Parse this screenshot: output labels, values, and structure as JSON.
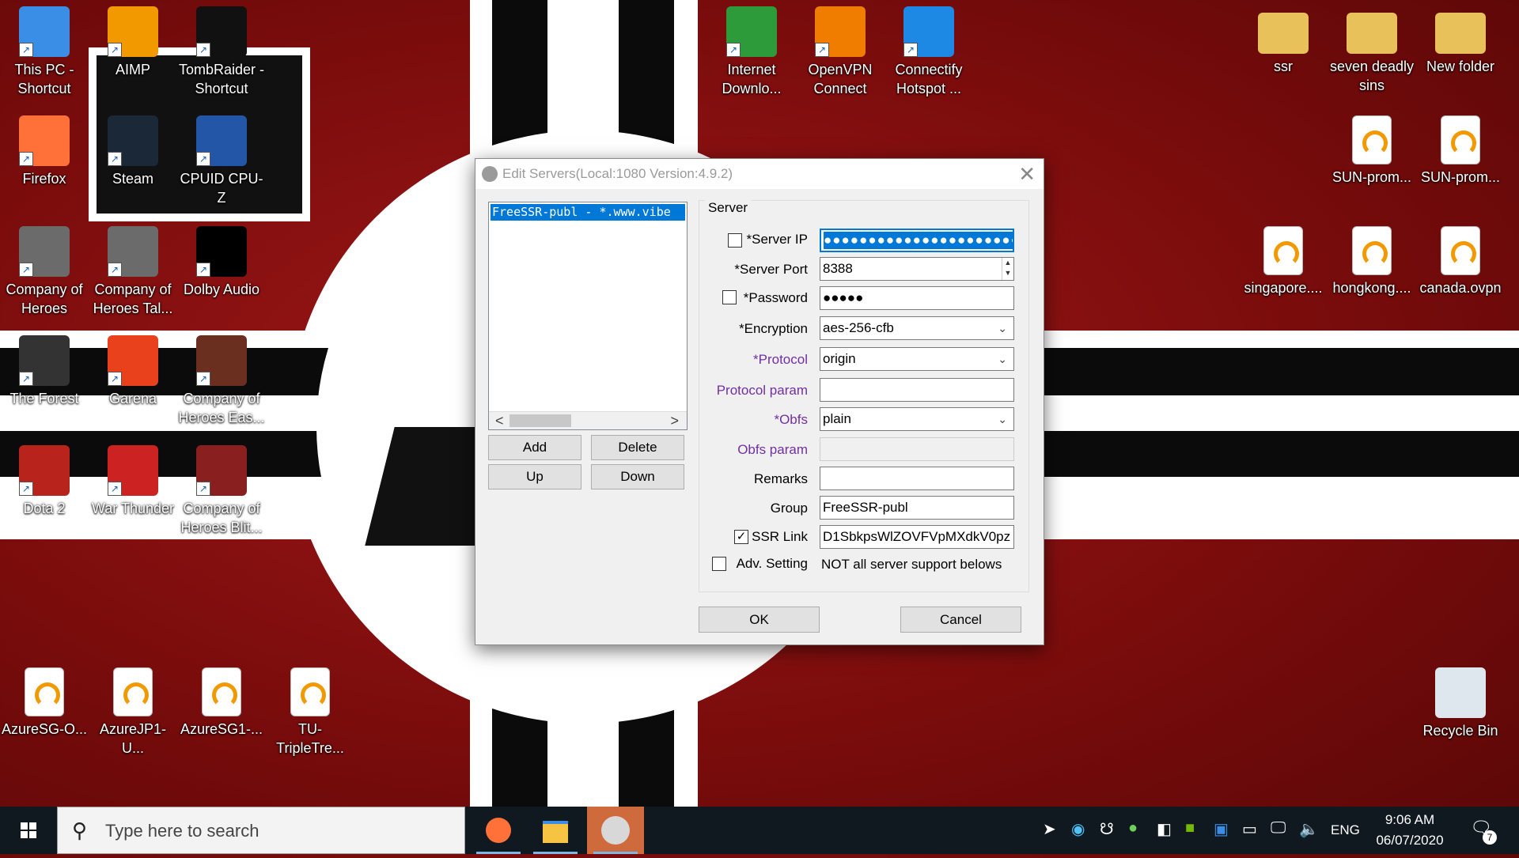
{
  "desktop": {
    "icons_left": [
      {
        "label": "This PC - Shortcut",
        "icon": "this-pc-icon",
        "color": "#3a8ee6"
      },
      {
        "label": "AIMP",
        "icon": "aimp-icon",
        "color": "#f29900"
      },
      {
        "label": "TombRaider - Shortcut",
        "icon": "tomb-raider-icon",
        "color": "#111111"
      },
      {
        "label": "Firefox",
        "icon": "firefox-icon",
        "color": "#ff7139"
      },
      {
        "label": "Steam",
        "icon": "steam-icon",
        "color": "#1b2838"
      },
      {
        "label": "CPUID CPU-Z",
        "icon": "cpuz-icon",
        "color": "#2456a8"
      },
      {
        "label": "Company of Heroes",
        "icon": "company-of-heroes-icon",
        "color": "#6b6b6b"
      },
      {
        "label": "Company of Heroes Tal...",
        "icon": "company-of-heroes-tales-icon",
        "color": "#6b6b6b"
      },
      {
        "label": "Dolby Audio",
        "icon": "dolby-audio-icon",
        "color": "#000000"
      },
      {
        "label": "The Forest",
        "icon": "the-forest-icon",
        "color": "#333333"
      },
      {
        "label": "Garena",
        "icon": "garena-icon",
        "color": "#e8411c"
      },
      {
        "label": "Company of Heroes Eas...",
        "icon": "company-of-heroes-eastern-icon",
        "color": "#6a2f1e"
      },
      {
        "label": "Dota 2",
        "icon": "dota2-icon",
        "color": "#b8231c"
      },
      {
        "label": "War Thunder",
        "icon": "war-thunder-icon",
        "color": "#cc2222"
      },
      {
        "label": "Company of Heroes Blit...",
        "icon": "company-of-heroes-blitz-icon",
        "color": "#8a1f1f"
      },
      {
        "label": "AzureSG-O...",
        "icon": "ovpn-file-icon"
      },
      {
        "label": "AzureJP1-U...",
        "icon": "ovpn-file-icon"
      },
      {
        "label": "AzureSG1-...",
        "icon": "ovpn-file-icon"
      },
      {
        "label": "TU-TripleTre...",
        "icon": "ovpn-file-icon"
      }
    ],
    "icons_top": [
      {
        "label": "Internet Downlo...",
        "icon": "idm-icon",
        "color": "#2e9b3a"
      },
      {
        "label": "OpenVPN Connect",
        "icon": "openvpn-icon",
        "color": "#f07d00"
      },
      {
        "label": "Connectify Hotspot ...",
        "icon": "connectify-icon",
        "color": "#1e88e5"
      }
    ],
    "icons_right": [
      {
        "label": "ssr",
        "icon": "folder-icon",
        "color": "#e8c15a"
      },
      {
        "label": "seven deadly sins",
        "icon": "folder-icon",
        "color": "#e8c15a"
      },
      {
        "label": "New folder",
        "icon": "folder-icon",
        "color": "#e8c15a"
      },
      {
        "label": "SUN-prom...",
        "icon": "ovpn-file-icon"
      },
      {
        "label": "SUN-prom...",
        "icon": "ovpn-file-icon"
      },
      {
        "label": "singapore....",
        "icon": "ovpn-file-icon"
      },
      {
        "label": "hongkong....",
        "icon": "ovpn-file-icon"
      },
      {
        "label": "canada.ovpn",
        "icon": "ovpn-file-icon"
      },
      {
        "label": "Recycle Bin",
        "icon": "recycle-bin-icon",
        "color": "#dfe7ee"
      }
    ]
  },
  "dialog": {
    "title": "Edit Servers(Local:1080 Version:4.9.2)",
    "server_list": [
      "FreeSSR-publ - *.www.vibe"
    ],
    "buttons": {
      "add": "Add",
      "delete": "Delete",
      "up": "Up",
      "down": "Down",
      "ok": "OK",
      "cancel": "Cancel"
    },
    "group_title": "Server",
    "fields": {
      "server_ip": {
        "label": "*Server IP",
        "value": "●●●●●●●●●●●●●●●●●●●●●●●●"
      },
      "server_port": {
        "label": "*Server Port",
        "value": "8388"
      },
      "password": {
        "label": "*Password",
        "value": "●●●●●"
      },
      "encryption": {
        "label": "*Encryption",
        "value": "aes-256-cfb"
      },
      "protocol": {
        "label": "*Protocol",
        "value": "origin"
      },
      "protocol_param": {
        "label": "Protocol param",
        "value": ""
      },
      "obfs": {
        "label": "*Obfs",
        "value": "plain"
      },
      "obfs_param": {
        "label": "Obfs param",
        "value": ""
      },
      "remarks": {
        "label": "Remarks",
        "value": ""
      },
      "group": {
        "label": "Group",
        "value": "FreeSSR-publ"
      },
      "ssr_link": {
        "label": "SSR Link",
        "value": "D1SbkpsWlZOVFVpMXdkV0pz"
      },
      "adv_setting": {
        "label": "Adv. Setting",
        "note": "NOT all server support belows"
      }
    },
    "checkboxes": {
      "show_ip": false,
      "show_password": false,
      "ssr_link": true,
      "adv_setting": false
    },
    "scroll_left": "<",
    "scroll_right": ">"
  },
  "taskbar": {
    "search_placeholder": "Type here to search",
    "language": "ENG",
    "time": "9:06 AM",
    "date": "06/07/2020",
    "notifications": "7"
  }
}
